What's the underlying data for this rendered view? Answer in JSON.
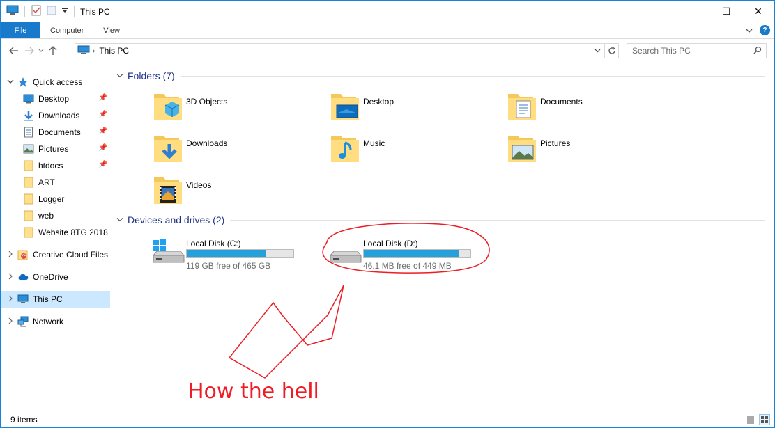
{
  "window": {
    "title": "This PC",
    "controls": {
      "minimize": "—",
      "maximize": "☐",
      "close": "✕"
    }
  },
  "ribbon": {
    "tabs": [
      "File",
      "Computer",
      "View"
    ],
    "help": "?"
  },
  "address": {
    "path": "This PC",
    "search_placeholder": "Search This PC"
  },
  "sidebar": {
    "quick_access": "Quick access",
    "pinned": [
      {
        "label": "Desktop",
        "icon": "desktop-icon",
        "pinned": true
      },
      {
        "label": "Downloads",
        "icon": "downloads-icon",
        "pinned": true
      },
      {
        "label": "Documents",
        "icon": "documents-icon",
        "pinned": true
      },
      {
        "label": "Pictures",
        "icon": "pictures-icon",
        "pinned": true
      },
      {
        "label": "htdocs",
        "icon": "folder-icon",
        "pinned": true
      },
      {
        "label": "ART",
        "icon": "folder-icon",
        "pinned": false
      },
      {
        "label": "Logger",
        "icon": "folder-icon",
        "pinned": false
      },
      {
        "label": "web",
        "icon": "folder-icon",
        "pinned": false
      },
      {
        "label": "Website 8TG 2018",
        "icon": "folder-icon",
        "pinned": false
      }
    ],
    "creative_cloud": "Creative Cloud Files",
    "onedrive": "OneDrive",
    "this_pc": "This PC",
    "network": "Network"
  },
  "main": {
    "folders_header": "Folders (7)",
    "folders": [
      {
        "label": "3D Objects",
        "icon": "3d-objects-icon"
      },
      {
        "label": "Desktop",
        "icon": "desktop-folder-icon"
      },
      {
        "label": "Documents",
        "icon": "documents-folder-icon"
      },
      {
        "label": "Downloads",
        "icon": "downloads-folder-icon"
      },
      {
        "label": "Music",
        "icon": "music-folder-icon"
      },
      {
        "label": "Pictures",
        "icon": "pictures-folder-icon"
      },
      {
        "label": "Videos",
        "icon": "videos-folder-icon"
      }
    ],
    "drives_header": "Devices and drives (2)",
    "drives": [
      {
        "name": "Local Disk (C:)",
        "free": "119 GB free of 465 GB",
        "used_fraction": 0.744,
        "icon": "windows-drive-icon"
      },
      {
        "name": "Local Disk (D:)",
        "free": "46.1 MB free of 449 MB",
        "used_fraction": 0.897,
        "icon": "drive-icon"
      }
    ]
  },
  "status": {
    "items": "9 items"
  },
  "annotation": {
    "text": "How the hell",
    "color": "#ee1c24"
  },
  "colors": {
    "accent": "#1979ca",
    "selection": "#cce8ff",
    "bar_fill": "#26a0da",
    "header_text": "#1e3287"
  }
}
